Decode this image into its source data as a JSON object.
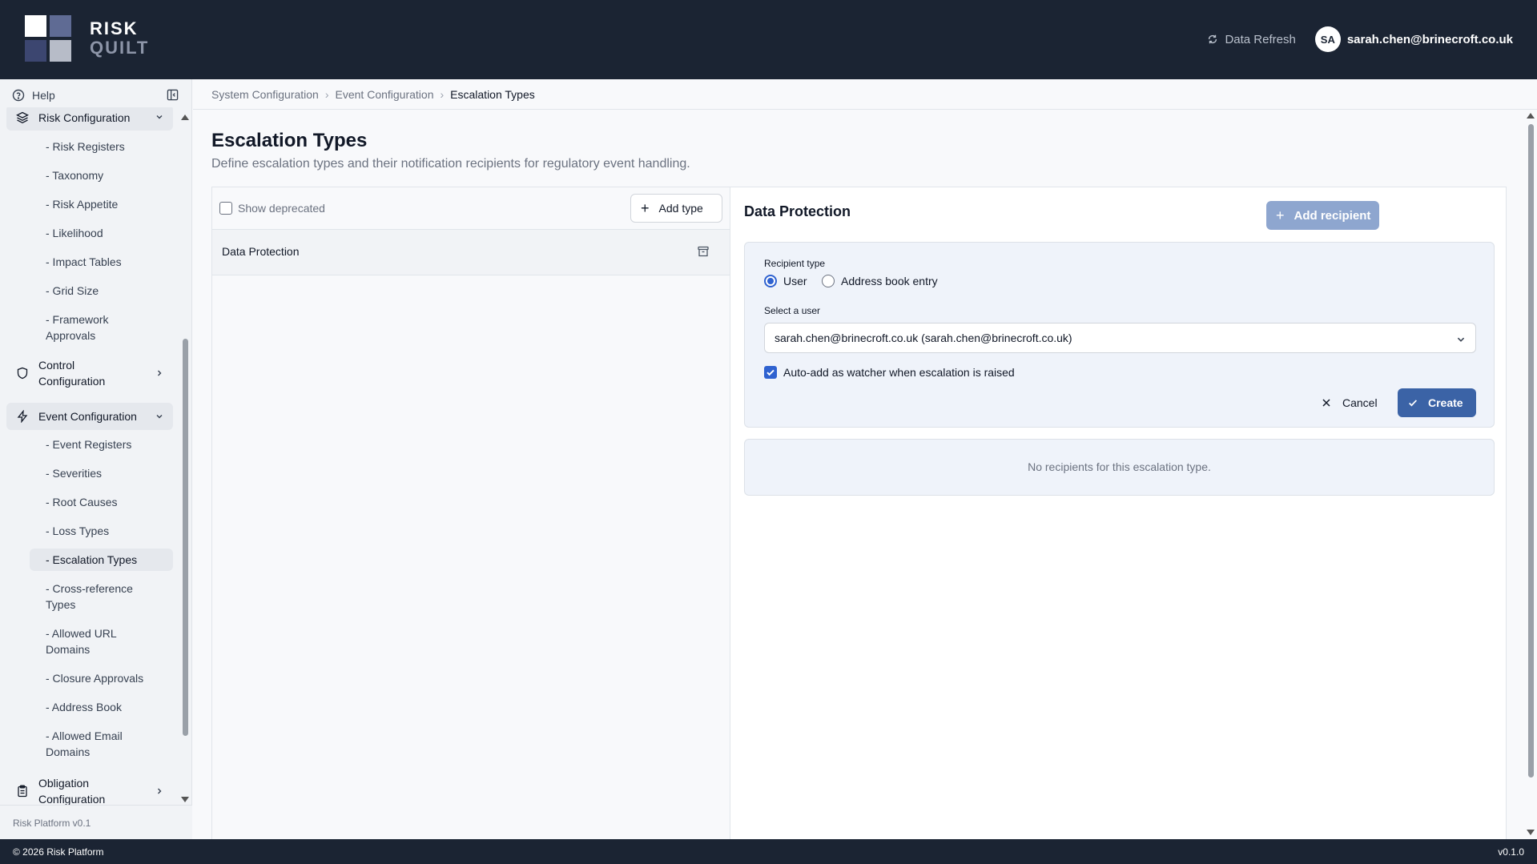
{
  "brand": {
    "line1": "RISK",
    "line2": "QUILT"
  },
  "header": {
    "refresh_label": "Data Refresh",
    "avatar_initials": "SA",
    "user_email": "sarah.chen@brinecroft.co.uk"
  },
  "sidebar": {
    "help_label": "Help",
    "risk_group": "Risk Configuration",
    "risk_items": [
      "- Risk Registers",
      "- Taxonomy",
      "- Risk Appetite",
      "- Likelihood",
      "- Impact Tables",
      "- Grid Size",
      "- Framework Approvals"
    ],
    "control_group": "Control Configuration",
    "event_group": "Event Configuration",
    "event_items": [
      "- Event Registers",
      "- Severities",
      "- Root Causes",
      "- Loss Types",
      "- Escalation Types",
      "- Cross-reference Types",
      "- Allowed URL Domains",
      "- Closure Approvals",
      "- Address Book",
      "- Allowed Email Domains"
    ],
    "obligation_group": "Obligation Configuration",
    "version_label": "Risk Platform v0.1"
  },
  "breadcrumb": [
    "System Configuration",
    "Event Configuration",
    "Escalation Types"
  ],
  "page": {
    "title": "Escalation Types",
    "subtitle": "Define escalation types and their notification recipients for regulatory event handling."
  },
  "types_pane": {
    "show_deprecated_label": "Show deprecated",
    "add_type_label": "Add type",
    "types": [
      "Data Protection"
    ]
  },
  "detail": {
    "title": "Data Protection",
    "add_recipient_label": "Add recipient",
    "recipient_type_label": "Recipient type",
    "option_user": "User",
    "option_address": "Address book entry",
    "select_user_label": "Select a user",
    "selected_user": "sarah.chen@brinecroft.co.uk (sarah.chen@brinecroft.co.uk)",
    "auto_add_label": "Auto-add as watcher when escalation is raised",
    "cancel_label": "Cancel",
    "create_label": "Create",
    "empty_text": "No recipients for this escalation type."
  },
  "footer": {
    "copyright": "© 2026 Risk Platform",
    "version": "v0.1.0"
  },
  "colors": {
    "header_bg": "#1b2433",
    "primary": "#3b63a6",
    "accent": "#2f62d0"
  }
}
